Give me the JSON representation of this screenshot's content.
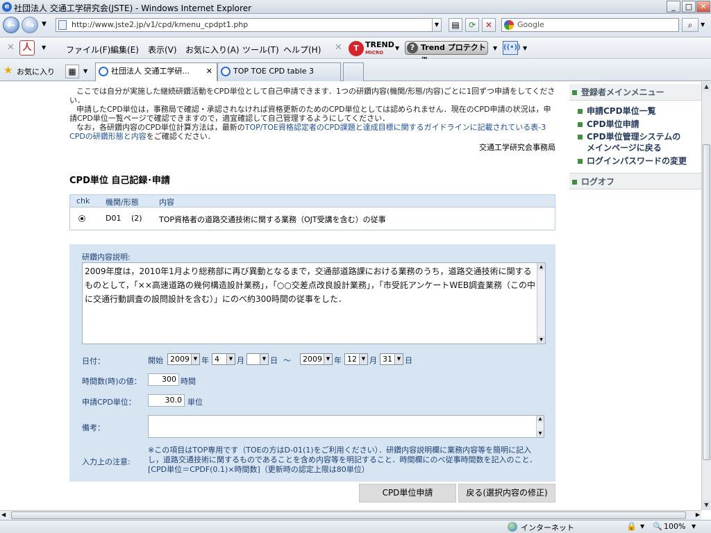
{
  "window": {
    "title": "社団法人 交通工学研究会(JSTE) - Windows Internet Explorer"
  },
  "addressbar": {
    "url": "http://www.jste2.jp/v1/cpd/kmenu_cpdpt1.php",
    "search_placeholder": "Google"
  },
  "menubar": {
    "items": [
      "ファイル(F)",
      "編集(E)",
      "表示(V)",
      "お気に入り(A)",
      "ツール(T)",
      "ヘルプ(H)"
    ],
    "trend_top": "TREND",
    "trend_bottom": "MICRO",
    "trend_protect": "Trend プロテクト™"
  },
  "favbar": {
    "favorites": "お気に入り"
  },
  "tabs": [
    {
      "label": "社団法人 交通工学研...",
      "active": true
    },
    {
      "label": "TOP TOE CPD table 3",
      "active": false
    }
  ],
  "intro": {
    "p1": "ここでは自分が実施した継続研鑽活動をCPD単位として自己申請できます．1つの研鑽内容(機関/形態/内容)ごとに1回ずつ申請をしてください．",
    "p2": "申請したCPD単位は，事務局で確認・承認されなければ資格更新のためのCPD単位としては認められません．現在のCPD申請の状況は，申請CPD単位一覧ページで確認できますので，適宜確認して自己管理するようにしてください．",
    "p3_a": "なお，各研鑽内容のCPD単位計算方法は，最新の",
    "p3_link": "TOP/TOE資格認定者のCPD課題と達成目標に関するガイドラインに記載されている表-3 CPDの研鑽形態と内容",
    "p3_b": "をご確認ください．",
    "office": "交通工学研究会事務局"
  },
  "section": {
    "title": "CPD単位 自己記録･申請"
  },
  "table": {
    "headers": {
      "chk": "chk",
      "org": "機関/形態",
      "content": "内容"
    },
    "row": {
      "code": "D01",
      "num": "(2)",
      "content": "TOP資格者の道路交通技術に関する業務（OJT受講を含む）の従事"
    }
  },
  "form": {
    "desc_label": "研鑽内容説明:",
    "desc_text": "2009年度は，2010年1月より総務部に再び異動となるまで，交通部道路課における業務のうち，道路交通技術に関するものとして，「××高速道路の幾何構造設計業務」，「○○交差点改良設計業務」，「市受託アンケートWEB調査業務（この中に交通行動調査の設問設計を含む）」にのべ約300時間の従事をした．",
    "date_label": "日付：",
    "start_label": "開始",
    "start_year": "2009",
    "start_month": "4",
    "start_day": "",
    "tilde": "〜",
    "end_year": "2009",
    "end_month": "12",
    "end_day": "31",
    "year_unit": "年",
    "month_unit": "月",
    "day_unit": "日",
    "hours_label": "時間数(時)の値：",
    "hours_value": "300",
    "hours_unit": "時間",
    "units_label": "申請CPD単位：",
    "units_value": "30.0",
    "units_unit": "単位",
    "notes_label": "備考：",
    "notes_value": "",
    "caution_label": "入力上の注意:",
    "caution_text": "※この項目はTOP専用です（TOEの方はD-01(1)をご利用ください）．研鑽内容説明欄に業務内容等を簡明に記入し，道路交通技術に関するものであることを含め内容等を明記すること．時間欄にのべ従事時間数を記入のこと．[CPD単位＝CPDF(0.1)×時間数]（更新時の認定上限は80単位）"
  },
  "buttons": {
    "submit": "CPD単位申請",
    "back": "戻る(選択内容の修正)"
  },
  "sidebar": {
    "head": "登録者メインメニュー",
    "items": [
      "申請CPD単位一覧",
      "CPD単位申請",
      "CPD単位管理システムの",
      "メインページに戻る",
      "ログインパスワードの変更"
    ],
    "logoff": "ログオフ"
  },
  "statusbar": {
    "zone": "インターネット",
    "zoom": "100%"
  }
}
